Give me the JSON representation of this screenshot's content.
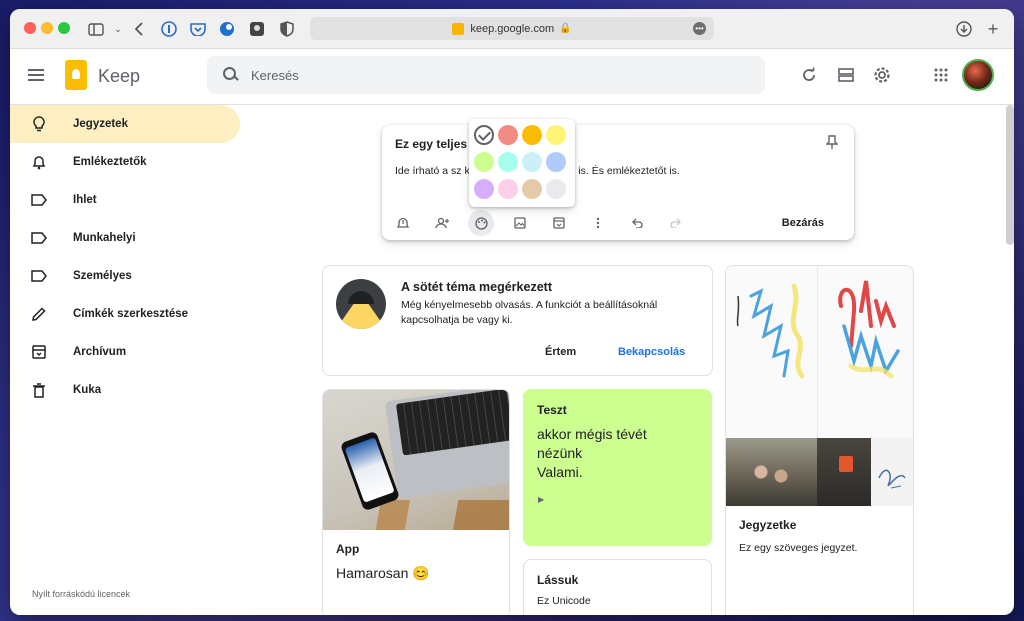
{
  "browser": {
    "url": "keep.google.com"
  },
  "app": {
    "name": "Keep",
    "search_placeholder": "Keresés"
  },
  "sidebar": {
    "items": [
      {
        "label": "Jegyzetek",
        "icon": "lightbulb-icon",
        "active": true
      },
      {
        "label": "Emlékeztetők",
        "icon": "bell-icon",
        "active": false
      },
      {
        "label": "Ihlet",
        "icon": "label-icon",
        "active": false
      },
      {
        "label": "Munkahelyi",
        "icon": "label-icon",
        "active": false
      },
      {
        "label": "Személyes",
        "icon": "label-icon",
        "active": false
      },
      {
        "label": "Címkék szerkesztése",
        "icon": "pencil-icon",
        "active": false
      },
      {
        "label": "Archívum",
        "icon": "archive-icon",
        "active": false
      },
      {
        "label": "Kuka",
        "icon": "trash-icon",
        "active": false
      }
    ],
    "footer": "Nyílt forráskódú licencek"
  },
  "editor": {
    "title": "Ez egy teljes",
    "body": "Ide írható a sz                             képet, hangfelvételt stb. is. És emlékeztetőt is.",
    "close_label": "Bezárás"
  },
  "palette": {
    "colors": [
      "#ffffff",
      "#f28b82",
      "#fbbc04",
      "#fff475",
      "#ccff90",
      "#a7ffeb",
      "#cbf0f8",
      "#aecbfa",
      "#d7aefb",
      "#fdcfe8",
      "#e6c9a8",
      "#e8eaed"
    ]
  },
  "cards": {
    "dark_theme": {
      "title": "A sötét téma megérkezett",
      "text": "Még kényelmesebb olvasás. A funkciót a beállításoknál kapcsolhatja be vagy ki.",
      "dismiss_label": "Értem",
      "enable_label": "Bekapcsolás"
    },
    "app": {
      "title": "App",
      "text": "Hamarosan 😊"
    },
    "teszt": {
      "title": "Teszt",
      "lines": [
        "akkor mégis tévét",
        "nézünk",
        "Valami."
      ],
      "color": "#ccff90"
    },
    "lassuk": {
      "title": "Lássuk",
      "text": "Ez Unicode"
    },
    "jegyzetke": {
      "title": "Jegyzetke",
      "text": "Ez egy szöveges jegyzet."
    }
  }
}
